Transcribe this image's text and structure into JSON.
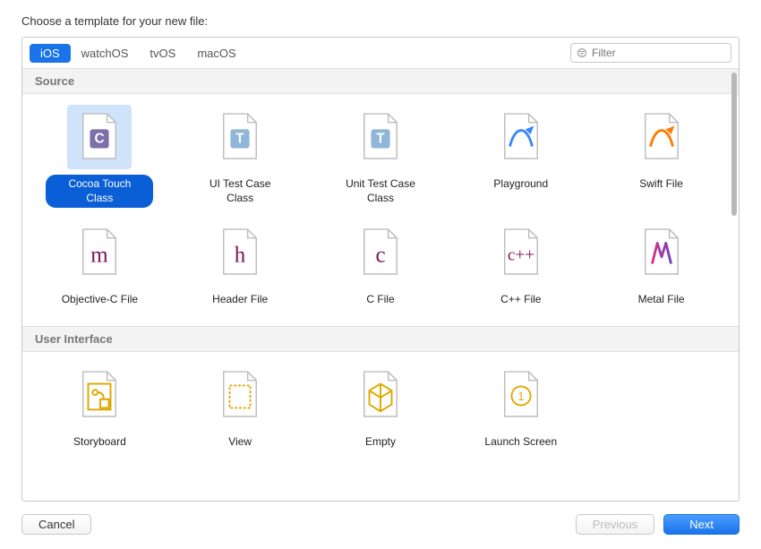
{
  "header": {
    "title": "Choose a template for your new file:"
  },
  "tabs": [
    {
      "label": "iOS",
      "selected": true
    },
    {
      "label": "watchOS",
      "selected": false
    },
    {
      "label": "tvOS",
      "selected": false
    },
    {
      "label": "macOS",
      "selected": false
    }
  ],
  "filter": {
    "placeholder": "Filter"
  },
  "sections": [
    {
      "title": "Source",
      "items": [
        {
          "label": "Cocoa Touch Class",
          "icon": "cocoa-touch",
          "selected": true
        },
        {
          "label": "UI Test Case Class",
          "icon": "ui-test",
          "selected": false
        },
        {
          "label": "Unit Test Case Class",
          "icon": "unit-test",
          "selected": false
        },
        {
          "label": "Playground",
          "icon": "playground",
          "selected": false
        },
        {
          "label": "Swift File",
          "icon": "swift",
          "selected": false
        },
        {
          "label": "Objective-C File",
          "icon": "objc-m",
          "selected": false
        },
        {
          "label": "Header File",
          "icon": "header-h",
          "selected": false
        },
        {
          "label": "C File",
          "icon": "c-file",
          "selected": false
        },
        {
          "label": "C++ File",
          "icon": "cpp-file",
          "selected": false
        },
        {
          "label": "Metal File",
          "icon": "metal",
          "selected": false
        }
      ]
    },
    {
      "title": "User Interface",
      "items": [
        {
          "label": "Storyboard",
          "icon": "storyboard",
          "selected": false
        },
        {
          "label": "View",
          "icon": "view",
          "selected": false
        },
        {
          "label": "Empty",
          "icon": "empty",
          "selected": false
        },
        {
          "label": "Launch Screen",
          "icon": "launch",
          "selected": false
        }
      ]
    }
  ],
  "footer": {
    "cancel": "Cancel",
    "previous": "Previous",
    "next": "Next"
  }
}
